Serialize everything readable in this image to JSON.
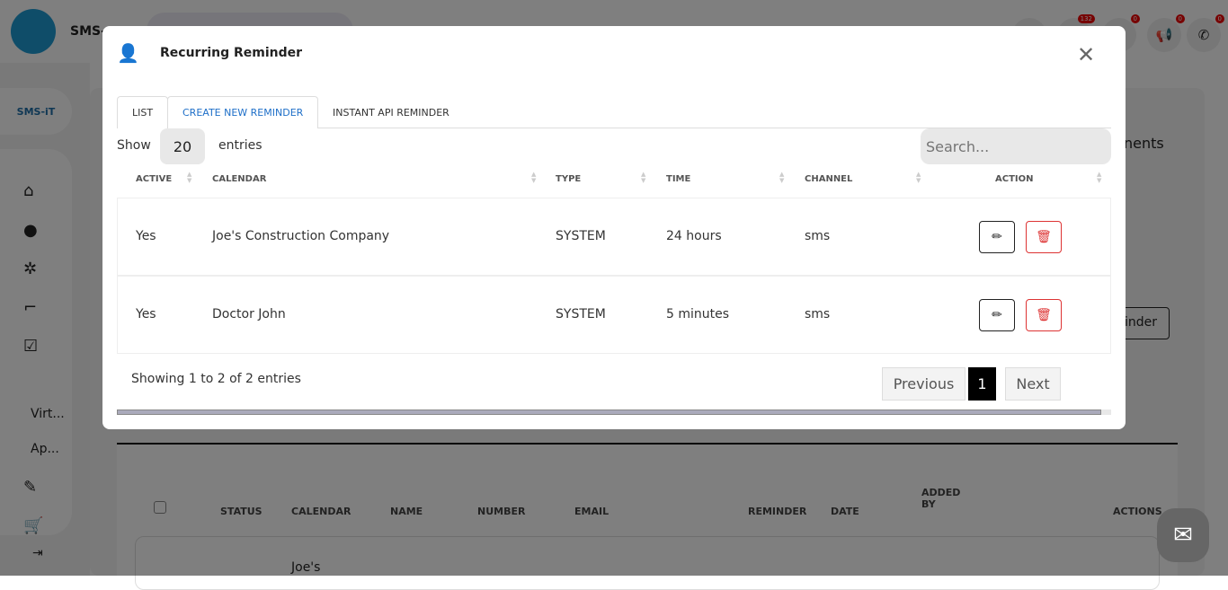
{
  "topbar": {
    "brand": "SMS-",
    "badges": [
      "132",
      "0",
      "0",
      "0"
    ]
  },
  "sidebar": {
    "logo": "SMS-iT",
    "items": [
      "Virt...",
      "Ap..."
    ]
  },
  "background": {
    "partial_text": "nents",
    "reminder_btn": "inder",
    "columns": [
      "STATUS",
      "CALENDAR",
      "NAME",
      "NUMBER",
      "EMAIL",
      "REMINDER",
      "DATE",
      "ADDED BY",
      "ACTIONS"
    ],
    "first_cell": "Joe's"
  },
  "modal": {
    "title": "Recurring Reminder",
    "tabs": [
      {
        "label": "LIST"
      },
      {
        "label": "CREATE NEW REMINDER"
      },
      {
        "label": "INSTANT API REMINDER"
      }
    ],
    "show_label": "Show",
    "entries_value": "20",
    "entries_label": "entries",
    "search_placeholder": "Search...",
    "columns": [
      "ACTIVE",
      "CALENDAR",
      "TYPE",
      "TIME",
      "CHANNEL",
      "ACTION"
    ],
    "rows": [
      {
        "active": "Yes",
        "calendar": "Joe's Construction Company",
        "type": "SYSTEM",
        "time": "24 hours",
        "channel": "sms"
      },
      {
        "active": "Yes",
        "calendar": "Doctor John",
        "type": "SYSTEM",
        "time": "5 minutes",
        "channel": "sms"
      }
    ],
    "info": "Showing 1 to 2 of 2 entries",
    "pagination": {
      "previous": "Previous",
      "current": "1",
      "next": "Next"
    }
  }
}
